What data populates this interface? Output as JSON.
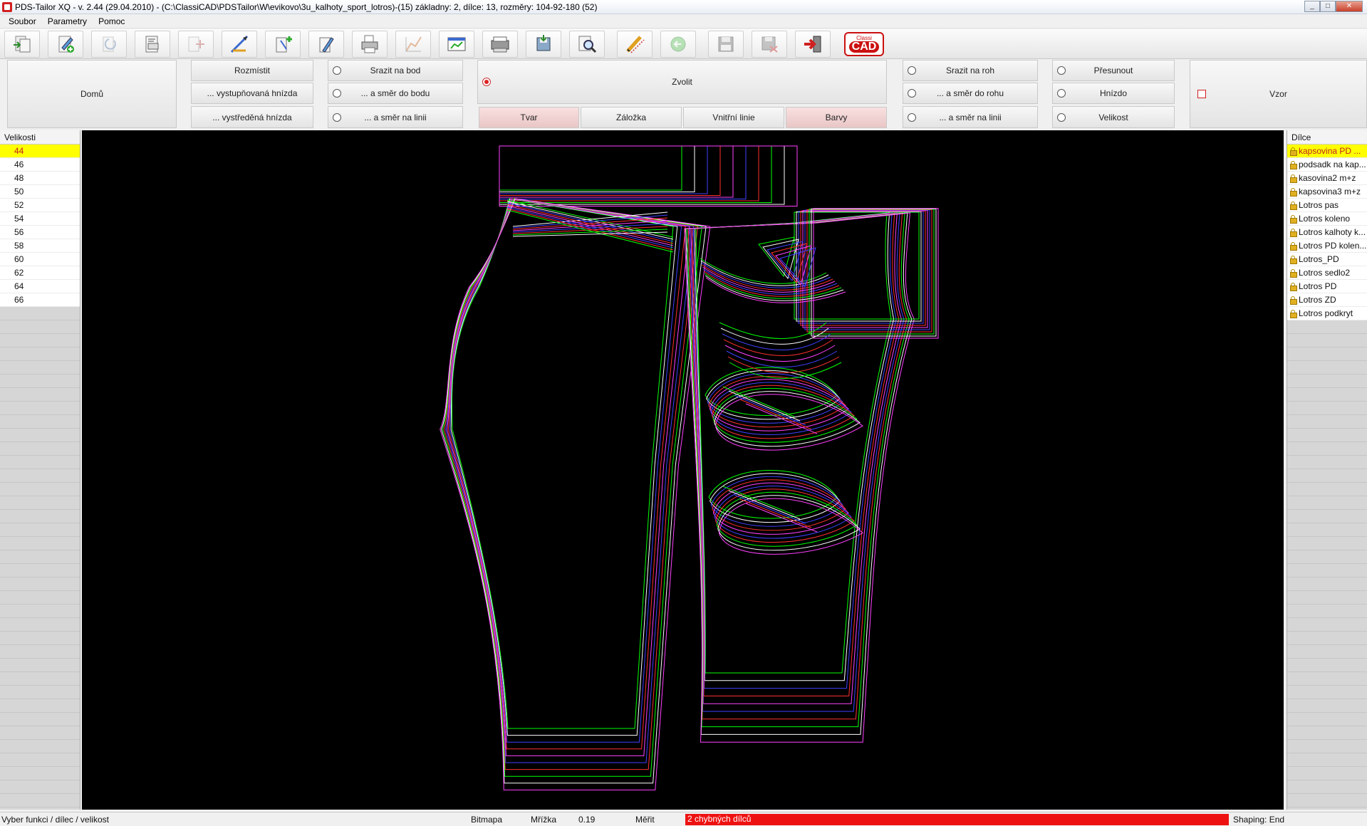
{
  "window": {
    "title": "PDS-Tailor XQ - v. 2.44 (29.04.2010) - (C:\\ClassiCAD\\PDSTailor\\W\\evikovo\\3u_kalhoty_sport_lotros)-(15) základny: 2, dílce: 13, rozměry: 104-92-180 (52)"
  },
  "menu": [
    "Soubor",
    "Parametry",
    "Pomoc"
  ],
  "toolbar": {
    "buttons": [
      "import-icon",
      "edit-add-icon",
      "rotate-icon",
      "measure-table-icon",
      "grading-icon",
      "ruler-pen-icon",
      "add-part-icon",
      "edit-part-icon",
      "print-icon",
      "graph-icon",
      "chart-window-icon",
      "plotter-icon",
      "save-export-icon",
      "zoom-preview-icon",
      "pencil-ruler-icon",
      "back-arrow-icon",
      "floppy-save-icon",
      "save-as-icon",
      "exit-icon"
    ],
    "logo_top": "Classi",
    "logo_main": "CAD"
  },
  "panel": {
    "domu": "Domů",
    "rozmistit": "Rozmístit",
    "vystupnovana": "... vystupňovaná hnízda",
    "vystredena": "... vystředěná hnízda",
    "srazit_bod": "Srazit na bod",
    "smer_bodu": "... a směr do bodu",
    "smer_linii1": "... a směr na linii",
    "zvolit": "Zvolit",
    "tab_tvar": "Tvar",
    "tab_zalozka": "Záložka",
    "tab_vnitrni": "Vnitřní linie",
    "tab_barvy": "Barvy",
    "srazit_roh": "Srazit na roh",
    "smer_rohu": "... a směr do rohu",
    "smer_linii2": "... a směr na linii",
    "presunout": "Přesunout",
    "hnizdo": "Hnízdo",
    "velikost": "Velikost",
    "vzor": "Vzor"
  },
  "sizes": {
    "header": "Velikosti",
    "selected": "44",
    "items": [
      "44",
      "46",
      "48",
      "50",
      "52",
      "54",
      "56",
      "58",
      "60",
      "62",
      "64",
      "66"
    ]
  },
  "parts": {
    "header": "Dílce",
    "items": [
      "kapsovina  PD ...",
      "podsadk na kap...",
      "kasovina2 m+z",
      "kapsovina3 m+z",
      "Lotros pas",
      "Lotros koleno",
      "Lotros kalhoty k...",
      "Lotros PD kolen...",
      "Lotros_PD",
      "Lotros sedlo2",
      "Lotros PD",
      "Lotros ZD",
      "Lotros podkryt"
    ]
  },
  "status": {
    "hint": "Vyber funkci / dílec / velikost",
    "bitmapa": "Bitmapa",
    "mrizka": "Mřížka",
    "mrizka_value": "0.19",
    "merit": "Měřit",
    "error": "2 chybných dílců",
    "shaping": "Shaping: End"
  },
  "colors": {
    "canvas_bg": "#000000",
    "grade_lines": [
      "#00ff00",
      "#ffffff",
      "#4040ff",
      "#ff3030",
      "#ff40ff",
      "#ffff00"
    ],
    "selected_bg": "#ffff00",
    "error_bg": "#ee1111"
  }
}
